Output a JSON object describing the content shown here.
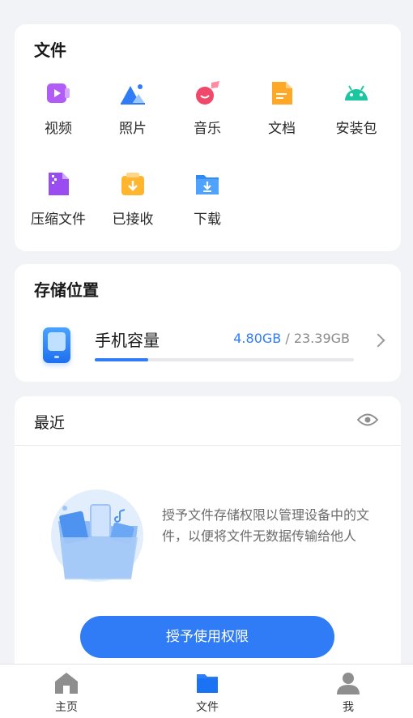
{
  "files": {
    "title": "文件",
    "categories": [
      {
        "label": "视频",
        "icon": "video-icon"
      },
      {
        "label": "照片",
        "icon": "photo-icon"
      },
      {
        "label": "音乐",
        "icon": "music-icon"
      },
      {
        "label": "文档",
        "icon": "document-icon"
      },
      {
        "label": "安装包",
        "icon": "android-package-icon"
      },
      {
        "label": "压缩文件",
        "icon": "archive-icon"
      },
      {
        "label": "已接收",
        "icon": "received-icon"
      },
      {
        "label": "下载",
        "icon": "download-folder-icon"
      }
    ]
  },
  "storage": {
    "title": "存储位置",
    "device_name": "手机容量",
    "used": "4.80GB",
    "separator": " / ",
    "total": "23.39GB",
    "used_fraction": 0.205
  },
  "recent": {
    "title": "最近",
    "permission_text": "授予文件存储权限以管理设备中的文件，以便将文件无数据传输给他人",
    "grant_button": "授予使用权限"
  },
  "nav": {
    "items": [
      {
        "label": "主页",
        "icon": "home-icon",
        "active": false
      },
      {
        "label": "文件",
        "icon": "folder-icon",
        "active": true
      },
      {
        "label": "我",
        "icon": "profile-icon",
        "active": false
      }
    ]
  },
  "colors": {
    "accent": "#2f7cf6",
    "background": "#f1f3f7"
  }
}
